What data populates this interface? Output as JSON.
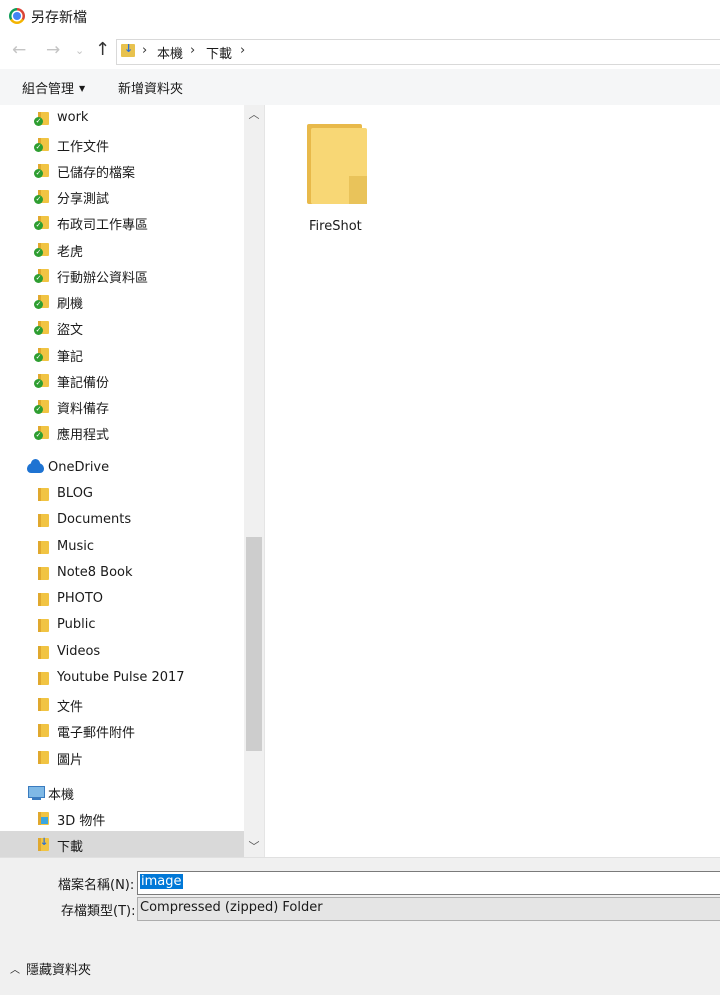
{
  "window": {
    "title": "另存新檔"
  },
  "nav": {
    "back": "←",
    "forward": "→",
    "recent": "⌄",
    "up": "↑",
    "breadcrumb": [
      "本機",
      "下載"
    ],
    "sep": "›"
  },
  "toolbar": {
    "organize": "組合管理",
    "new_folder": "新增資料夾"
  },
  "sidebar": {
    "quick_items": [
      "work",
      "工作文件",
      "已儲存的檔案",
      "分享測試",
      "布政司工作專區",
      "老虎",
      "行動辦公資料區",
      "刷機",
      "盜文",
      "筆記",
      "筆記備份",
      "資料備存",
      "應用程式"
    ],
    "onedrive": "OneDrive",
    "onedrive_items": [
      "BLOG",
      "Documents",
      "Music",
      "Note8 Book",
      "PHOTO",
      "Public",
      "Videos",
      "Youtube Pulse 2017",
      "文件",
      "電子郵件附件",
      "圖片"
    ],
    "this_pc": "本機",
    "pc_items": [
      "3D 物件",
      "下載"
    ]
  },
  "content": {
    "items": [
      {
        "name": "FireShot",
        "icon": "folder-icon"
      }
    ]
  },
  "form": {
    "filename_label": "檔案名稱(N):",
    "filename_value": "image",
    "type_label": "存檔類型(T):",
    "type_value": "Compressed (zipped) Folder",
    "hide_folders": "隱藏資料夾"
  },
  "colors": {
    "selection": "#0078d7",
    "folder": "#f8d775",
    "onedrive": "#1e73d2",
    "sync_ok": "#2e9e31"
  }
}
